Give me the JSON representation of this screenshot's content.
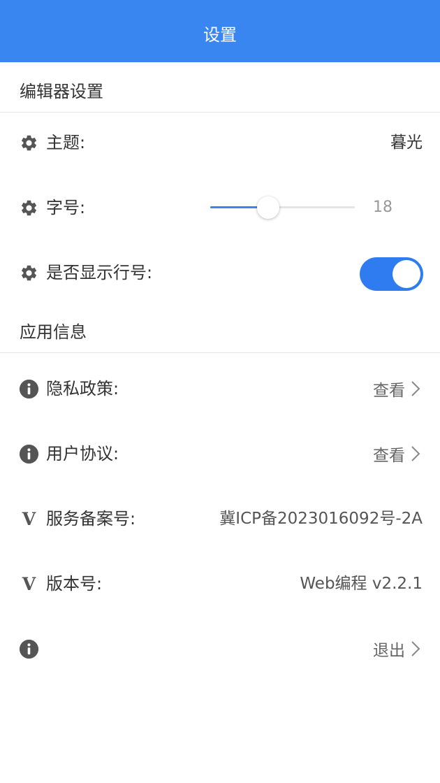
{
  "header": {
    "title": "设置",
    "background": "#3a86f0"
  },
  "editor_section": {
    "title": "编辑器设置",
    "theme": {
      "label": "主题:",
      "value": "暮光",
      "icon": "gear-icon"
    },
    "font_size": {
      "label": "字号:",
      "value": "18",
      "slider_fraction": 0.4,
      "icon": "gear-icon"
    },
    "line_numbers": {
      "label": "是否显示行号:",
      "enabled": true,
      "icon": "gear-icon"
    }
  },
  "app_section": {
    "title": "应用信息",
    "privacy": {
      "label": "隐私政策:",
      "action": "查看",
      "icon": "info-icon"
    },
    "agreement": {
      "label": "用户协议:",
      "action": "查看",
      "icon": "info-icon"
    },
    "icp": {
      "label": "服务备案号:",
      "value": "冀ICP备2023016092号-2A",
      "icon": "v-icon",
      "icon_glyph": "V"
    },
    "version": {
      "label": "版本号:",
      "value": "Web编程 v2.2.1",
      "icon": "v-icon",
      "icon_glyph": "V"
    },
    "logout": {
      "action": "退出",
      "icon": "info-icon"
    }
  },
  "colors": {
    "accent": "#3a86f0",
    "toggle_on": "#2e7cf0",
    "icon_gray": "#555555"
  }
}
